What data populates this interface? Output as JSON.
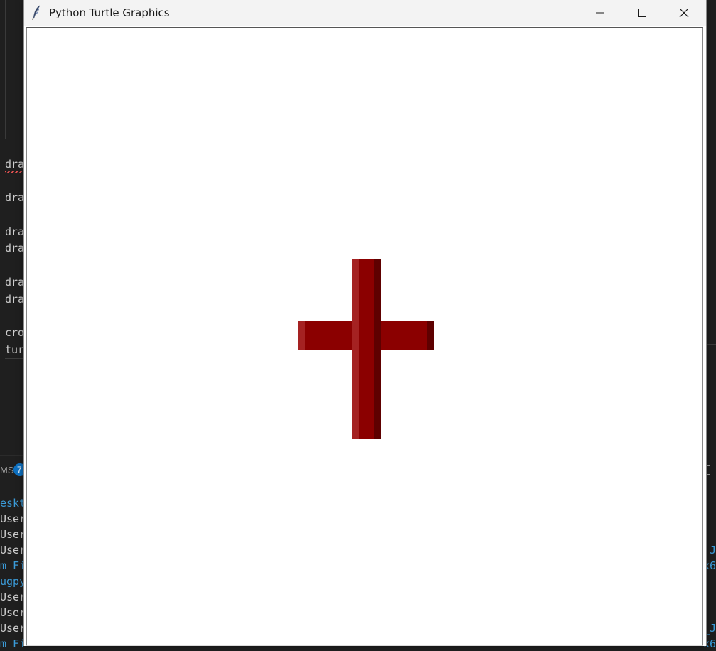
{
  "editor": {
    "code_lines": [
      "dra",
      "dra",
      "dra",
      "dra",
      "dra",
      "dra",
      "cro",
      "tur"
    ]
  },
  "panel": {
    "problems_label": "MS",
    "problems_count": "7"
  },
  "terminal": {
    "lines": [
      "eskt",
      "User",
      "User",
      "User",
      "m Fi",
      "ugpy",
      "User",
      "User",
      "User",
      "m Fi"
    ],
    "right_fragments": [
      "_J",
      "x6",
      "_J",
      "x6"
    ]
  },
  "turtle_window": {
    "title": "Python Turtle Graphics",
    "icons": {
      "app": "feather-icon",
      "minimize": "minimize-icon",
      "maximize": "maximize-icon",
      "close": "close-icon"
    },
    "cross": {
      "shape": "cross",
      "colors": {
        "main": "#8b0000",
        "highlight": "#a52222",
        "shadow": "#5e0000"
      }
    }
  }
}
